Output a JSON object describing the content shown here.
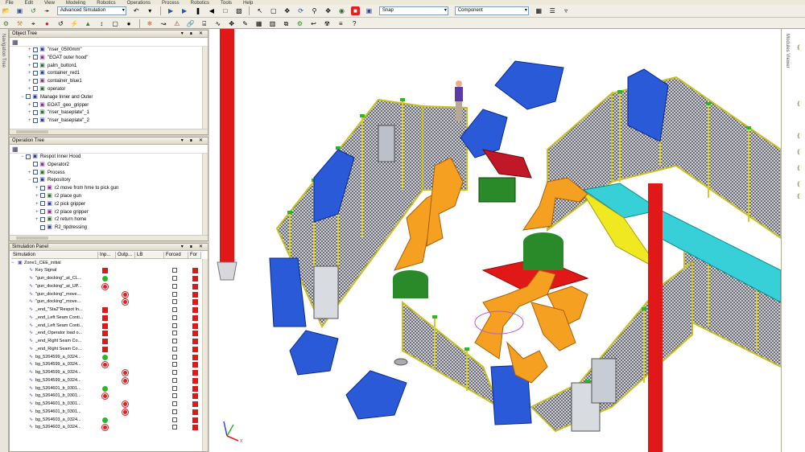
{
  "app": {
    "menu": [
      "File",
      "Edit",
      "View",
      "Modeling",
      "Robotics",
      "Operations",
      "Process",
      "Robotics",
      "Tools",
      "Help"
    ]
  },
  "toolbar": {
    "study_combo": "Advanced Simulation",
    "snap_combo": "Snap",
    "component_combo": "Component"
  },
  "left_strip": {
    "label": "Navigation Tree"
  },
  "right_strip": {
    "label": "Modules Viewer"
  },
  "object_tree": {
    "title": "Object Tree",
    "items": [
      {
        "label": "\"riser_0500mm\"",
        "indent": 3,
        "expand": "+"
      },
      {
        "label": "\"EOAT outer hood\"",
        "indent": 3,
        "expand": "+"
      },
      {
        "label": "palm_button1",
        "indent": 3,
        "expand": "+"
      },
      {
        "label": "container_red1",
        "indent": 3,
        "expand": "+"
      },
      {
        "label": "container_blue1",
        "indent": 3,
        "expand": "+"
      },
      {
        "label": "operator",
        "indent": 3,
        "expand": "+"
      },
      {
        "label": "Manage Inner and Outer",
        "indent": 2,
        "expand": "-"
      },
      {
        "label": "EOAT_geo_gripper",
        "indent": 3,
        "expand": "+"
      },
      {
        "label": "\"riser_baseplate\"_1",
        "indent": 3,
        "expand": "+"
      },
      {
        "label": "\"riser_baseplate\"_2",
        "indent": 3,
        "expand": "+"
      }
    ]
  },
  "operation_tree": {
    "title": "Operation Tree",
    "items": [
      {
        "label": "Respot Inner Hood",
        "indent": 2,
        "expand": "-"
      },
      {
        "label": "Operator2",
        "indent": 3,
        "expand": ""
      },
      {
        "label": "Process",
        "indent": 3,
        "expand": "+"
      },
      {
        "label": "Repository",
        "indent": 3,
        "expand": "-"
      },
      {
        "label": "r2 move from hme to pick gun",
        "indent": 4,
        "expand": "+"
      },
      {
        "label": "r2 place gun",
        "indent": 4,
        "expand": "+"
      },
      {
        "label": "r2 pick gripper",
        "indent": 4,
        "expand": "+"
      },
      {
        "label": "r2 place gripper",
        "indent": 4,
        "expand": "+"
      },
      {
        "label": "r2 return home",
        "indent": 4,
        "expand": "+"
      },
      {
        "label": "R2_tipdressing",
        "indent": 4,
        "expand": ""
      }
    ]
  },
  "simulation_panel": {
    "title": "Simulation Panel",
    "columns": [
      "Simulation",
      "Inp...",
      "Outp...",
      "LB",
      "Forced",
      "For"
    ],
    "root": "Zone1_CEE_initial",
    "rows": [
      {
        "name": "Key Signal",
        "inp": "red",
        "out": "",
        "forced": true
      },
      {
        "name": "\"gun_docking\"_at_CL...",
        "inp": "gdot",
        "out": "",
        "forced": true
      },
      {
        "name": "\"gun_docking\"_at_UP...",
        "inp": "rdot",
        "out": "",
        "forced": true
      },
      {
        "name": "\"gun_docking\"_move...",
        "inp": "",
        "out": "rdot",
        "forced": true
      },
      {
        "name": "\"gun_docking\"_move...",
        "inp": "",
        "out": "rdot",
        "forced": true
      },
      {
        "name": "_end_\"Sta2\"Respot In...",
        "inp": "red",
        "out": "",
        "forced": true
      },
      {
        "name": "_end_Left Seam Conti...",
        "inp": "red",
        "out": "",
        "forced": true
      },
      {
        "name": "_end_Left Seam Conti...",
        "inp": "red",
        "out": "",
        "forced": true
      },
      {
        "name": "_end_Operator load o...",
        "inp": "red",
        "out": "",
        "forced": true
      },
      {
        "name": "_end_Right Seam Co...",
        "inp": "red",
        "out": "",
        "forced": true
      },
      {
        "name": "_end_Right Seam Co...",
        "inp": "red",
        "out": "",
        "forced": true
      },
      {
        "name": "bg_5264599_a_0324...",
        "inp": "gdot",
        "out": "",
        "forced": true
      },
      {
        "name": "bg_5264599_a_0324...",
        "inp": "rdot",
        "out": "",
        "forced": true
      },
      {
        "name": "bg_5264599_a_0324...",
        "inp": "",
        "out": "rdot",
        "forced": true
      },
      {
        "name": "bg_5264599_a_0324...",
        "inp": "",
        "out": "rdot",
        "forced": true
      },
      {
        "name": "bg_5264601_b_0301...",
        "inp": "gdot",
        "out": "",
        "forced": true
      },
      {
        "name": "bg_5264601_b_0301...",
        "inp": "rdot",
        "out": "",
        "forced": true
      },
      {
        "name": "bg_5264601_b_0301...",
        "inp": "",
        "out": "rdot",
        "forced": true
      },
      {
        "name": "bg_5264601_b_0301...",
        "inp": "",
        "out": "rdot",
        "forced": true
      },
      {
        "name": "bg_5264603_a_0324...",
        "inp": "gdot",
        "out": "",
        "forced": true
      },
      {
        "name": "bg_5264603_a_0324...",
        "inp": "rdot",
        "out": "",
        "forced": true
      }
    ]
  },
  "viewport": {
    "axis_x": "X",
    "axis_y": "Y",
    "axis_z": "Z"
  },
  "colors": {
    "accent_red": "#e01818",
    "robot_orange": "#f5a020",
    "fence_yellow": "#d8d020",
    "container_blue": "#2a5ad8",
    "pedestal_green": "#2a8a2a"
  }
}
